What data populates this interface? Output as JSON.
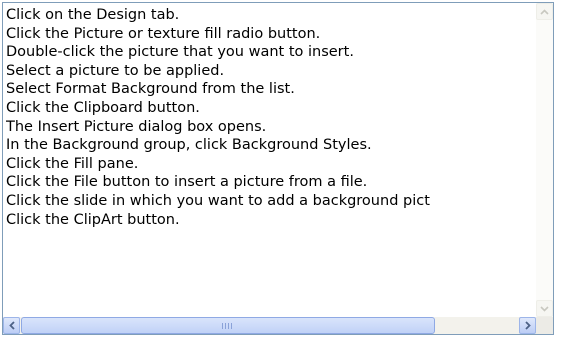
{
  "list": {
    "items": [
      "Click on the Design tab.",
      "Click the Picture or texture fill radio button.",
      "Double-click the picture that you want to insert.",
      "Select a picture to be applied.",
      "Select Format Background from the list.",
      "Click the Clipboard button.",
      "The Insert Picture dialog box opens.",
      "In the Background group, click Background Styles.",
      "Click the Fill pane.",
      "Click the File button to insert a picture from a file.",
      "Click the slide in which you want to add a background pict",
      "Click the ClipArt button."
    ]
  },
  "scrollbars": {
    "vertical": {
      "up_icon": "arrow-up-icon",
      "down_icon": "arrow-down-icon",
      "position": 0
    },
    "horizontal": {
      "left_icon": "arrow-left-icon",
      "right_icon": "arrow-right-icon",
      "position": 0
    }
  },
  "colors": {
    "border": "#7f9db9",
    "scroll_accent": "#4d6185"
  }
}
